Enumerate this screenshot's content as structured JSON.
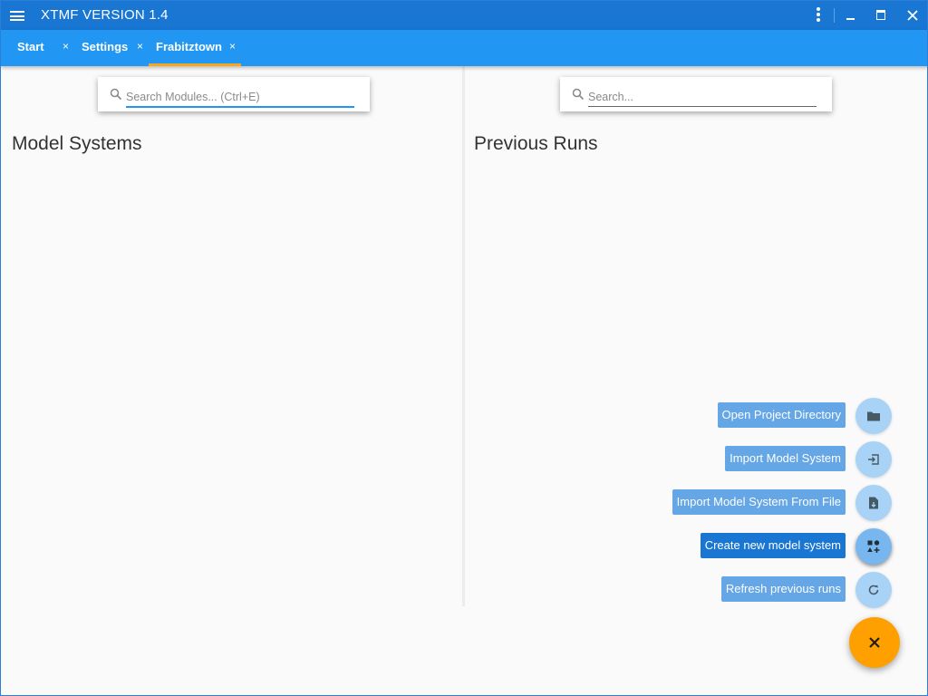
{
  "app": {
    "title": "XTMF VERSION 1.4"
  },
  "tabs": [
    {
      "label": "Start",
      "close": "×"
    },
    {
      "label": "Settings",
      "close": "×"
    },
    {
      "label": "Frabitztown",
      "close": "×"
    }
  ],
  "colors": {
    "titlebar": "#1976d2",
    "tabbar": "#2196f3",
    "tab_underline": "#f5a623",
    "fab_main": "#ffa000",
    "action_label": "#64a6e6",
    "action_label_active": "#1976d2"
  },
  "left_pane": {
    "search": {
      "placeholder": "Search Modules... (Ctrl+E)",
      "value": ""
    },
    "title": "Model Systems"
  },
  "right_pane": {
    "search": {
      "placeholder": "Search...",
      "value": ""
    },
    "title": "Previous Runs"
  },
  "actions": [
    {
      "label": "Open Project Directory",
      "icon": "folder-icon"
    },
    {
      "label": "Import Model System",
      "icon": "import-icon"
    },
    {
      "label": "Import Model System From File",
      "icon": "file-import-icon"
    },
    {
      "label": "Create new model system",
      "icon": "add-shapes-icon",
      "active": true
    },
    {
      "label": "Refresh previous runs",
      "icon": "refresh-icon"
    }
  ],
  "fab": {
    "icon": "close-icon"
  }
}
